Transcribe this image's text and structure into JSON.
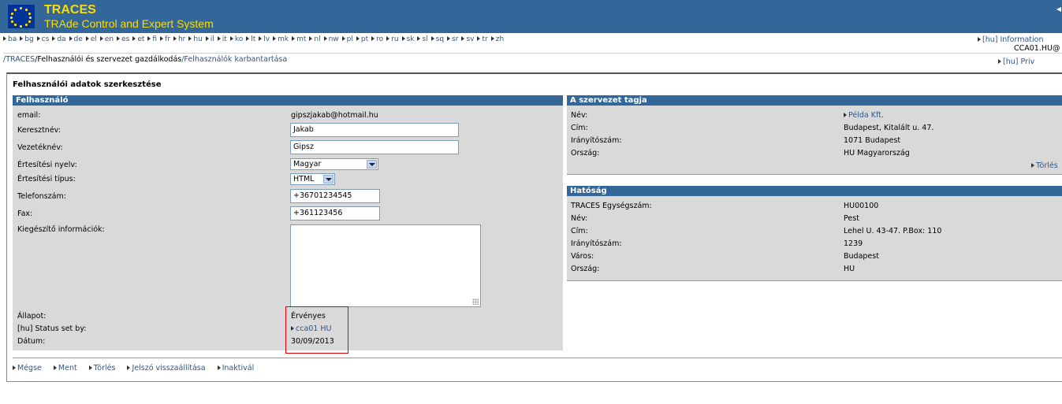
{
  "header": {
    "title_short": "TRACES",
    "title_long": "TRAde Control and Expert System"
  },
  "languages": [
    "ba",
    "bg",
    "cs",
    "da",
    "de",
    "el",
    "en",
    "es",
    "et",
    "fi",
    "fr",
    "hr",
    "hu",
    "il",
    "it",
    "ko",
    "lt",
    "lv",
    "mk",
    "mt",
    "nl",
    "nw",
    "pl",
    "pt",
    "ro",
    "ru",
    "sk",
    "sl",
    "sq",
    "sr",
    "sv",
    "tr",
    "zh"
  ],
  "top_right": {
    "information": "[hu] Information",
    "user": "CCA01.HU@",
    "privacy": "[hu] Priv"
  },
  "breadcrumb": {
    "root": "/TRACES",
    "middle": "/Felhasználói és szervezet gazdálkodás",
    "current": "/Felhasználók karbantartása"
  },
  "page_title": "Felhasználói adatok szerkesztése",
  "user_panel": {
    "heading": "Felhasználó",
    "email_label": "email:",
    "email_value": "gipszjakab@hotmail.hu",
    "first_name_label": "Keresztnév:",
    "first_name_value": "Jakab",
    "last_name_label": "Vezetéknév:",
    "last_name_value": "Gipsz",
    "lang_label": "Értesítési nyelv:",
    "lang_value": "Magyar",
    "type_label": "Értesítési típus:",
    "type_value": "HTML",
    "phone_label": "Telefonszám:",
    "phone_value": "+36701234545",
    "fax_label": "Fax:",
    "fax_value": "+361123456",
    "info_label": "Kiegészítő információk:",
    "status_label": "Állapot:",
    "status_value": "Érvényes",
    "status_by_label": "[hu] Status set by:",
    "status_by_value": "cca01 HU",
    "date_label": "Dátum:",
    "date_value": "30/09/2013"
  },
  "org_panel": {
    "heading": "A szervezet tagja",
    "name_label": "Név:",
    "name_value": "Példa Kft.",
    "address_label": "Cím:",
    "address_value": "Budapest, Kitalált u. 47.",
    "zip_label": "Irányítószám:",
    "zip_value": "1071 Budapest",
    "country_label": "Ország:",
    "country_value": "HU Magyarország",
    "delete_link": "Törlés"
  },
  "authority_panel": {
    "heading": "Hatóság",
    "unit_label": "TRACES Egységszám:",
    "unit_value": "HU00100",
    "name_label": "Név:",
    "name_value": "Pest",
    "address_label": "Cím:",
    "address_value": "Lehel U. 43-47. P.Box: 110",
    "zip_label": "Irányítószám:",
    "zip_value": "1239",
    "city_label": "Város:",
    "city_value": "Budapest",
    "country_label": "Ország:",
    "country_value": "HU"
  },
  "actions": {
    "cancel": "Mégse",
    "save": "Ment",
    "delete": "Törlés",
    "reset_password": "Jelszó visszaállítása",
    "deactivate": "Inaktivál"
  }
}
